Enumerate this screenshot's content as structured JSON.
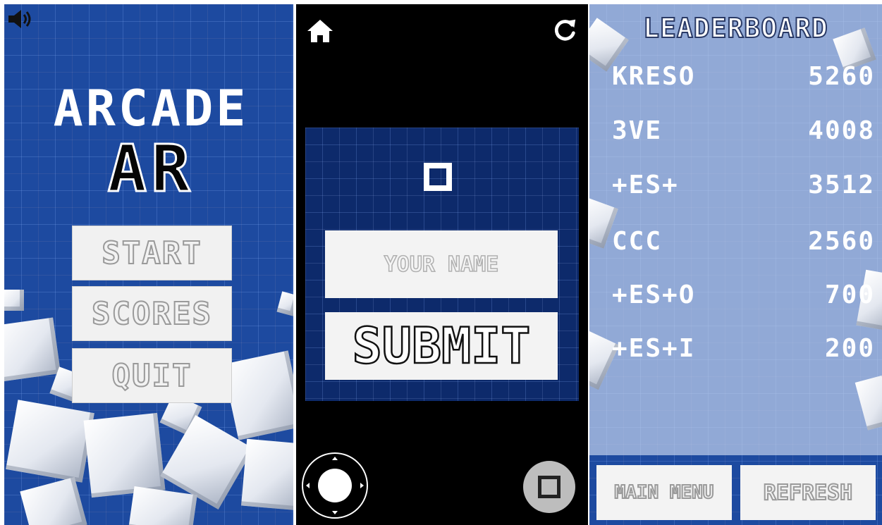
{
  "menu": {
    "title_line1": "ARCADE",
    "title_line2": "AR",
    "buttons": {
      "start": "START",
      "scores": "SCORES",
      "quit": "QUIT"
    }
  },
  "submit_screen": {
    "name_placeholder": "YOUR NAME",
    "submit_label": "SUBMIT"
  },
  "leaderboard": {
    "title": "LEADERBOARD",
    "rows": [
      {
        "name": "KRESO",
        "score": "5260"
      },
      {
        "name": "3VE",
        "score": "4008"
      },
      {
        "name": "+ES+",
        "score": "3512"
      },
      {
        "name": "CCC",
        "score": "2560"
      },
      {
        "name": "+ES+O",
        "score": "700"
      },
      {
        "name": "+ES+I",
        "score": "200"
      }
    ],
    "main_menu_label": "MAIN MENU",
    "refresh_label": "REFRESH"
  },
  "icons": {
    "sound": "speaker-icon",
    "home": "home-icon",
    "restart": "refresh-icon",
    "joystick": "joystick-icon",
    "action": "stop-square-icon"
  },
  "colors": {
    "grid_blue": "#1d4aa0",
    "card_blue": "#0d2a6b",
    "button_bg": "#f3f3f3",
    "board_overlay": "#c8d7f0"
  }
}
